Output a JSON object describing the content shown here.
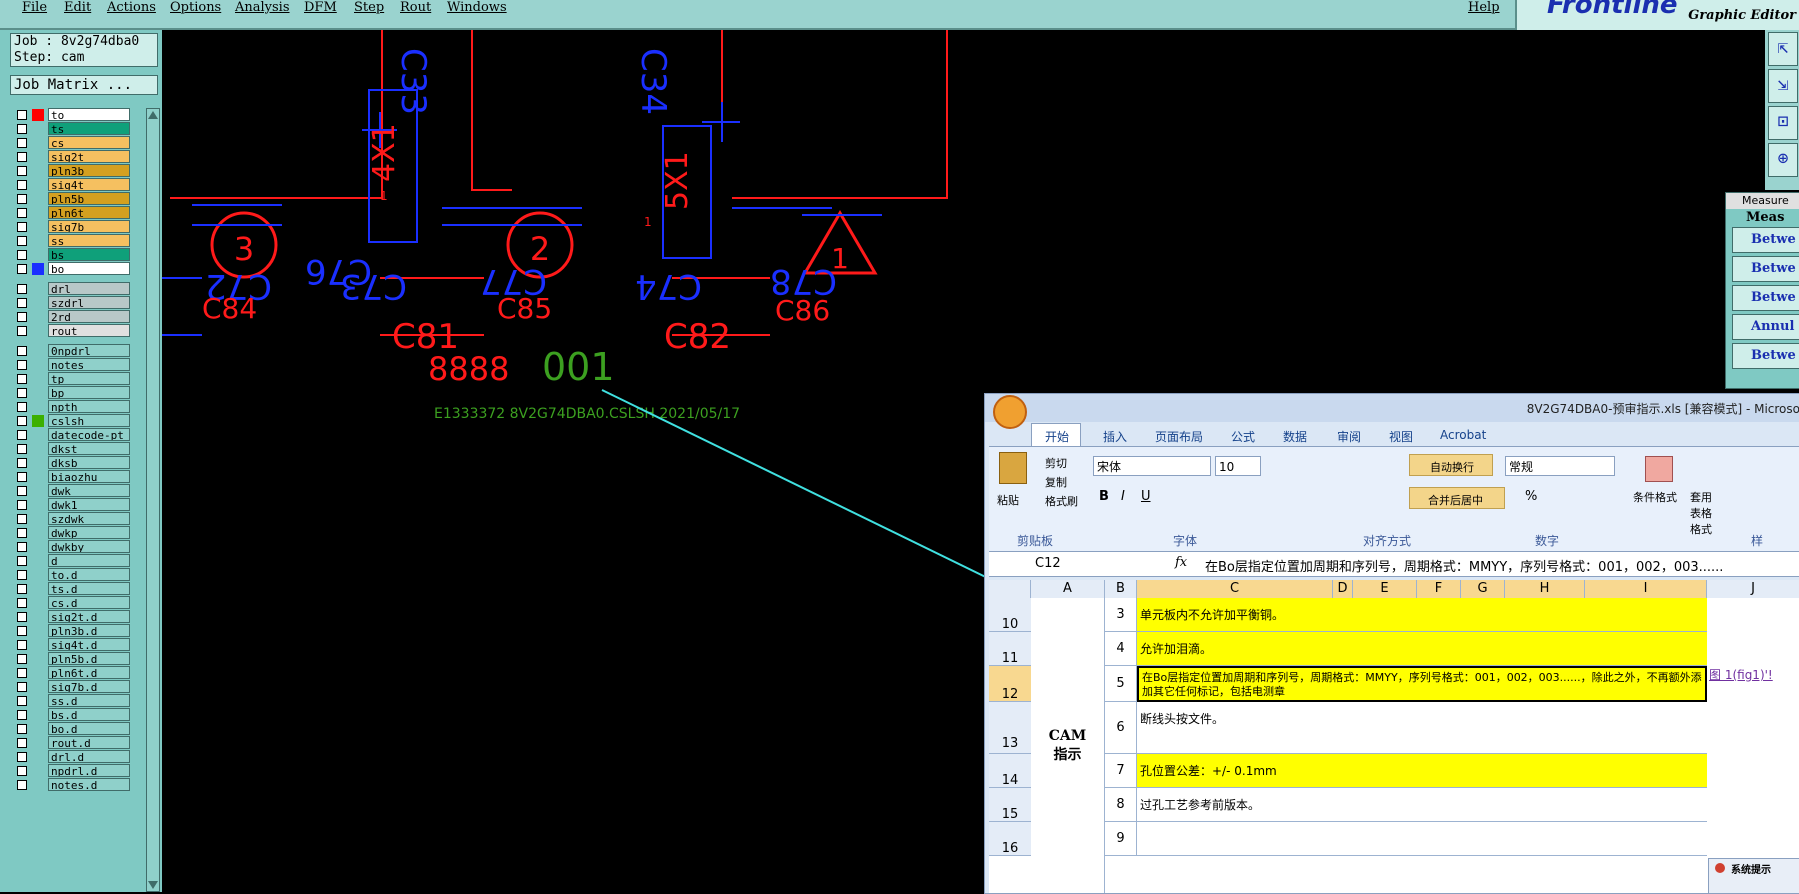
{
  "menu": {
    "items": [
      "File",
      "Edit",
      "Actions",
      "Options",
      "Analysis",
      "DFM",
      "Step",
      "Rout",
      "Windows"
    ],
    "help": "Help"
  },
  "brand": {
    "logo": "Frontline",
    "editor": "Graphic Editor"
  },
  "job": {
    "job_line": "Job : 8v2g74dba0",
    "step_line": "Step: cam",
    "matrix_button": "Job Matrix ..."
  },
  "layers": [
    {
      "name": "to",
      "color": "#ff0000",
      "bg": "#ffffff"
    },
    {
      "name": "ts",
      "color": "",
      "bg": "#0fa07a"
    },
    {
      "name": "cs",
      "color": "",
      "bg": "#f5c060"
    },
    {
      "name": "sig2t",
      "color": "",
      "bg": "#f5c060"
    },
    {
      "name": "pln3b",
      "color": "",
      "bg": "#d4a020"
    },
    {
      "name": "sig4t",
      "color": "",
      "bg": "#f5c060"
    },
    {
      "name": "pln5b",
      "color": "",
      "bg": "#d4a020"
    },
    {
      "name": "pln6t",
      "color": "",
      "bg": "#d4a020"
    },
    {
      "name": "sig7b",
      "color": "",
      "bg": "#f5c060"
    },
    {
      "name": "ss",
      "color": "",
      "bg": "#f5c060"
    },
    {
      "name": "bs",
      "color": "",
      "bg": "#0fa07a"
    },
    {
      "name": "bo",
      "color": "#1a2fff",
      "bg": "#ffffff"
    },
    {
      "name": "drl",
      "color": "",
      "bg": "#b8c8c8"
    },
    {
      "name": "szdrl",
      "color": "",
      "bg": "#b8c8c8"
    },
    {
      "name": "2rd",
      "color": "",
      "bg": "#b8c8c8"
    },
    {
      "name": "rout",
      "color": "",
      "bg": "#e0e0e0"
    },
    {
      "name": "0npdrl",
      "color": "",
      "bg": "#8fd0ca"
    },
    {
      "name": "notes",
      "color": "",
      "bg": "#8fd0ca"
    },
    {
      "name": "tp",
      "color": "",
      "bg": "#8fd0ca"
    },
    {
      "name": "bp",
      "color": "",
      "bg": "#8fd0ca"
    },
    {
      "name": "npth",
      "color": "",
      "bg": "#8fd0ca"
    },
    {
      "name": "cslsh",
      "color": "#3cb000",
      "bg": "#8fd0ca"
    },
    {
      "name": "datecode-pt",
      "color": "",
      "bg": "#8fd0ca"
    },
    {
      "name": "dkst",
      "color": "",
      "bg": "#8fd0ca"
    },
    {
      "name": "dksb",
      "color": "",
      "bg": "#8fd0ca"
    },
    {
      "name": "biaozhu",
      "color": "",
      "bg": "#8fd0ca"
    },
    {
      "name": "dwk",
      "color": "",
      "bg": "#8fd0ca"
    },
    {
      "name": "dwk1",
      "color": "",
      "bg": "#8fd0ca"
    },
    {
      "name": "szdwk",
      "color": "",
      "bg": "#8fd0ca"
    },
    {
      "name": "dwkp",
      "color": "",
      "bg": "#8fd0ca"
    },
    {
      "name": "dwkby",
      "color": "",
      "bg": "#8fd0ca"
    },
    {
      "name": "d",
      "color": "",
      "bg": "#8fd0ca"
    },
    {
      "name": "to.d",
      "color": "",
      "bg": "#8fd0ca"
    },
    {
      "name": "ts.d",
      "color": "",
      "bg": "#8fd0ca"
    },
    {
      "name": "cs.d",
      "color": "",
      "bg": "#8fd0ca"
    },
    {
      "name": "sig2t.d",
      "color": "",
      "bg": "#8fd0ca"
    },
    {
      "name": "pln3b.d",
      "color": "",
      "bg": "#8fd0ca"
    },
    {
      "name": "sig4t.d",
      "color": "",
      "bg": "#8fd0ca"
    },
    {
      "name": "pln5b.d",
      "color": "",
      "bg": "#8fd0ca"
    },
    {
      "name": "pln6t.d",
      "color": "",
      "bg": "#8fd0ca"
    },
    {
      "name": "sig7b.d",
      "color": "",
      "bg": "#8fd0ca"
    },
    {
      "name": "ss.d",
      "color": "",
      "bg": "#8fd0ca"
    },
    {
      "name": "bs.d",
      "color": "",
      "bg": "#8fd0ca"
    },
    {
      "name": "bo.d",
      "color": "",
      "bg": "#8fd0ca"
    },
    {
      "name": "rout.d",
      "color": "",
      "bg": "#8fd0ca"
    },
    {
      "name": "drl.d",
      "color": "",
      "bg": "#8fd0ca"
    },
    {
      "name": "npdrl.d",
      "color": "",
      "bg": "#8fd0ca"
    },
    {
      "name": "notes.d",
      "color": "",
      "bg": "#8fd0ca"
    }
  ],
  "canvas": {
    "labels": {
      "c84": "C84",
      "c85": "C85",
      "c86": "C86",
      "c81": "C81",
      "c82": "C82",
      "c33": "C33",
      "c34": "C34",
      "c76": "C76",
      "c72": "C72",
      "c73": "C73",
      "c77": "C77",
      "c74": "C74",
      "c78": "C78",
      "r4x1": "4X1",
      "r5x1": "5X1",
      "one": "1",
      "circle3": "3",
      "circle2": "2",
      "tri1": "1",
      "eights": "8888",
      "code": "001",
      "info": "E1333372 8V2G74DBA0.CSLSH 2021/05/17"
    }
  },
  "measure": {
    "title": "Measure",
    "header": "Meas",
    "rows": [
      "Betwe",
      "Betwe",
      "Betwe",
      "Annul",
      "Betwe"
    ]
  },
  "excel": {
    "title": "8V2G74DBA0-预审指示.xls [兼容模式] - Microso",
    "tabs": [
      "开始",
      "插入",
      "页面布局",
      "公式",
      "数据",
      "审阅",
      "视图",
      "Acrobat"
    ],
    "clipboard": {
      "paste": "粘贴",
      "cut": "剪切",
      "copy": "复制",
      "format": "格式刷",
      "group": "剪贴板"
    },
    "font": {
      "name": "宋体",
      "size": "10",
      "group": "字体"
    },
    "align": {
      "wrap": "自动换行",
      "merge": "合并后居中",
      "group": "对齐方式"
    },
    "number": {
      "format": "常规",
      "group": "数字"
    },
    "styles": {
      "cond": "条件格式",
      "table": "套用表格格式",
      "group": "样"
    },
    "namebox": "C12",
    "formula": "在Bo层指定位置加周期和序列号，周期格式：MMYY，序列号格式：001，002，003......",
    "columns": [
      "A",
      "B",
      "C",
      "D",
      "E",
      "F",
      "G",
      "H",
      "I",
      "J"
    ],
    "merged_label": "CAM 指示",
    "rows": [
      {
        "row": "10",
        "num": "3",
        "text": "单元板内不允许加平衡铜。",
        "fill": "#ffff00"
      },
      {
        "row": "11",
        "num": "4",
        "text": "允许加泪滴。",
        "fill": "#ffff00"
      },
      {
        "row": "12",
        "num": "5",
        "text": "在Bo层指定位置加周期和序列号，周期格式：MMYY，序列号格式：001，002，003......，除此之外，不再额外添加其它任何标记，包括电测章",
        "fill": "#ffff00",
        "link": "图 1(fig1)'!"
      },
      {
        "row": "13",
        "num": "6",
        "text": "断线头按文件。",
        "fill": "#ffffff"
      },
      {
        "row": "14",
        "num": "7",
        "text": "孔位置公差：+/- 0.1mm",
        "fill": "#ffff00"
      },
      {
        "row": "15",
        "num": "8",
        "text": "过孔工艺参考前版本。",
        "fill": "#ffffff"
      },
      {
        "row": "16",
        "num": "9",
        "text": "",
        "fill": "#ffffff"
      }
    ]
  },
  "popup": {
    "title": "系统提示"
  }
}
